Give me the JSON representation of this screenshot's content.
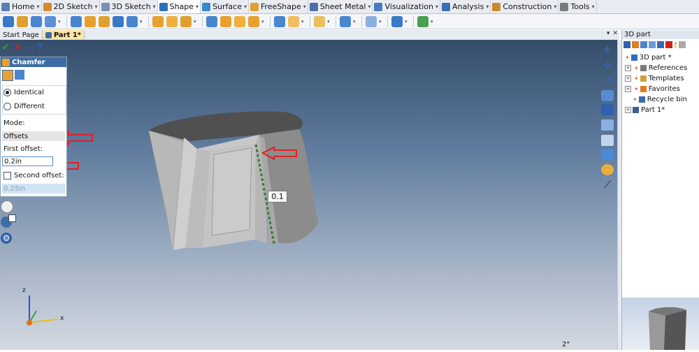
{
  "ribbon_tabs": [
    {
      "label": "Home",
      "color": "#5a7fb0"
    },
    {
      "label": "2D Sketch",
      "color": "#d8892b"
    },
    {
      "label": "3D Sketch",
      "color": "#7e8fb0"
    },
    {
      "label": "Shape",
      "color": "#2f6fbf"
    },
    {
      "label": "Surface",
      "color": "#3b86d1"
    },
    {
      "label": "FreeShape",
      "color": "#e0a030"
    },
    {
      "label": "Sheet Metal",
      "color": "#4f6fa6"
    },
    {
      "label": "Visualization",
      "color": "#4a7ac0"
    },
    {
      "label": "Analysis",
      "color": "#3d6db0"
    },
    {
      "label": "Construction",
      "color": "#c98a2e"
    },
    {
      "label": "Tools",
      "color": "#7a7a7a"
    }
  ],
  "document_tabs": {
    "start_page": "Start Page",
    "part": "Part 1*"
  },
  "chamfer_panel": {
    "title": "Chamfer",
    "option_identical": "Identical",
    "option_different": "Different",
    "mode_label": "Mode:",
    "mode_value": "Offsets",
    "first_offset_label": "First offset:",
    "first_offset_value": "0.2in",
    "second_offset_label": "Second offset:",
    "second_offset_value": "0.25in"
  },
  "viewport": {
    "dimension_label": "0.1",
    "scale_label": "2\"",
    "axis_z": "z",
    "axis_x": "x"
  },
  "right_panel": {
    "title": "3D part",
    "tree": [
      {
        "label": "3D part *",
        "level": 0,
        "expander": "",
        "icon_color": "#2f6fbf"
      },
      {
        "label": "References",
        "level": 1,
        "expander": "+",
        "icon_color": "#7a7a7a"
      },
      {
        "label": "Templates",
        "level": 1,
        "expander": "+",
        "icon_color": "#d0a040"
      },
      {
        "label": "Favorites",
        "level": 1,
        "expander": "+",
        "icon_color": "#e07a20"
      },
      {
        "label": "Recycle bin",
        "level": 1,
        "expander": "",
        "icon_color": "#3a6ab0"
      },
      {
        "label": "Part 1*",
        "level": 0,
        "expander": "+",
        "icon_color": "#3b5f9a"
      }
    ]
  },
  "colors": {
    "accent": "#3e6da6",
    "active_doc_tab": "#fbe4a7",
    "arrow": "#e02020"
  }
}
